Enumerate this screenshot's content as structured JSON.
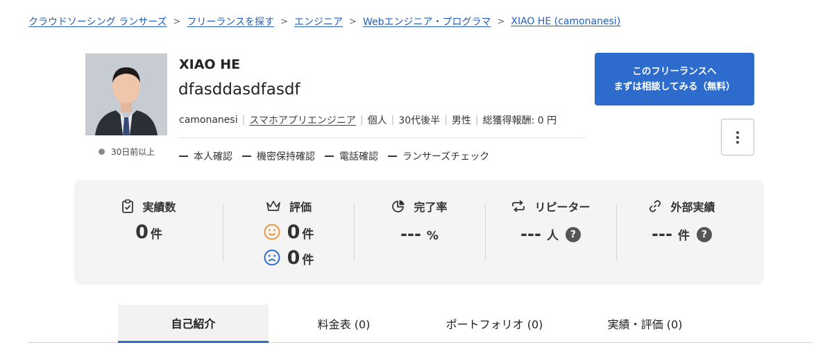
{
  "breadcrumb": [
    "クラウドソーシング ランサーズ",
    "フリーランスを探す",
    "エンジニア",
    "Webエンジニア・プログラマ",
    "XIAO HE (camonanesi)"
  ],
  "profile": {
    "name": "XIAO HE",
    "catchphrase": "dfasddasdfasdf",
    "login_status": "30日前以上",
    "username": "camonanesi",
    "category": "スマホアプリエンジニア",
    "type": "個人",
    "age": "30代後半",
    "gender": "男性",
    "earnings": "総獲得報酬: 0 円",
    "verifications": [
      "本人確認",
      "機密保持確認",
      "電話確認",
      "ランサーズチェック"
    ]
  },
  "cta": {
    "line1": "このフリーランスへ",
    "line2": "まずは相談してみる（無料）"
  },
  "stats": {
    "works": {
      "label": "実績数",
      "value": "0",
      "unit": "件"
    },
    "rating": {
      "label": "評価",
      "good": "0",
      "bad": "0",
      "unit": "件"
    },
    "completion": {
      "label": "完了率",
      "value": "---",
      "unit": "%"
    },
    "repeater": {
      "label": "リピーター",
      "value": "---",
      "unit": "人",
      "help": "?"
    },
    "external": {
      "label": "外部実績",
      "value": "---",
      "unit": "件",
      "help": "?"
    }
  },
  "tabs": [
    "自己紹介",
    "料金表 (0)",
    "ポートフォリオ (0)",
    "実績・評価 (0)"
  ],
  "colors": {
    "accent": "#2d6bcc",
    "link": "#1f5fbf",
    "good_face": "#e8963a",
    "bad_face": "#2d6bcc"
  },
  "icons": [
    "clipboard-check-icon",
    "crown-icon",
    "pie-chart-icon",
    "repeat-icon",
    "link-icon",
    "smile-face-icon",
    "sad-face-icon",
    "help-icon",
    "more-vertical-icon"
  ]
}
